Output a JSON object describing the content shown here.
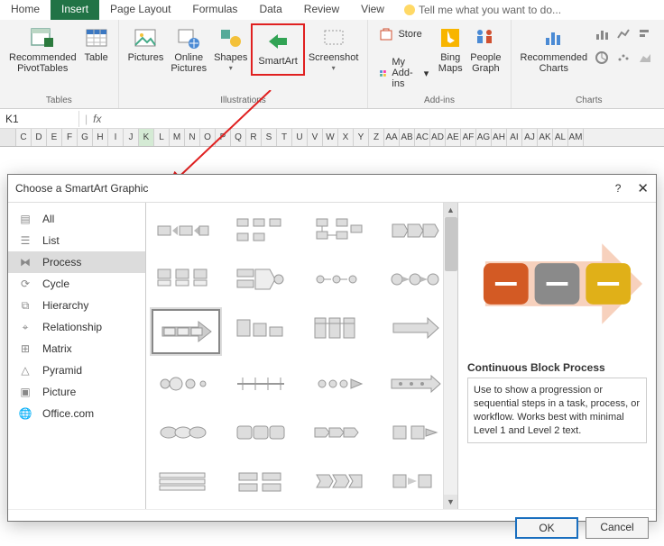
{
  "tabs": [
    "Home",
    "Insert",
    "Page Layout",
    "Formulas",
    "Data",
    "Review",
    "View"
  ],
  "active_tab": "Insert",
  "tell_me": "Tell me what you want to do...",
  "ribbon": {
    "groups": [
      {
        "label": "Tables",
        "items": [
          {
            "label": "Recommended\nPivotTables"
          },
          {
            "label": "Table"
          }
        ]
      },
      {
        "label": "Illustrations",
        "items": [
          {
            "label": "Pictures"
          },
          {
            "label": "Online\nPictures"
          },
          {
            "label": "Shapes"
          },
          {
            "label": "SmartArt"
          },
          {
            "label": "Screenshot"
          }
        ]
      },
      {
        "label": "Add-ins",
        "items": [
          {
            "label": "Store"
          },
          {
            "label": "My Add-ins"
          },
          {
            "label": "Bing\nMaps"
          },
          {
            "label": "People\nGraph"
          }
        ]
      },
      {
        "label": "Charts",
        "items": [
          {
            "label": "Recommended\nCharts"
          }
        ]
      }
    ]
  },
  "namebox": "K1",
  "fx_label": "fx",
  "columns": [
    "C",
    "D",
    "E",
    "F",
    "G",
    "H",
    "I",
    "J",
    "K",
    "L",
    "M",
    "N",
    "O",
    "P",
    "Q",
    "R",
    "S",
    "T",
    "U",
    "V",
    "W",
    "X",
    "Y",
    "Z",
    "AA",
    "AB",
    "AC",
    "AD",
    "AE",
    "AF",
    "AG",
    "AH",
    "AI",
    "AJ",
    "AK",
    "AL",
    "AM"
  ],
  "selected_col": "K",
  "dialog": {
    "title": "Choose a SmartArt Graphic",
    "help": "?",
    "categories": [
      "All",
      "List",
      "Process",
      "Cycle",
      "Hierarchy",
      "Relationship",
      "Matrix",
      "Pyramid",
      "Picture",
      "Office.com"
    ],
    "selected_category": "Process",
    "preview": {
      "title": "Continuous Block Process",
      "desc": "Use to show a progression or sequential steps in a task, process, or workflow. Works best with minimal Level 1 and Level 2 text."
    },
    "ok": "OK",
    "cancel": "Cancel"
  }
}
